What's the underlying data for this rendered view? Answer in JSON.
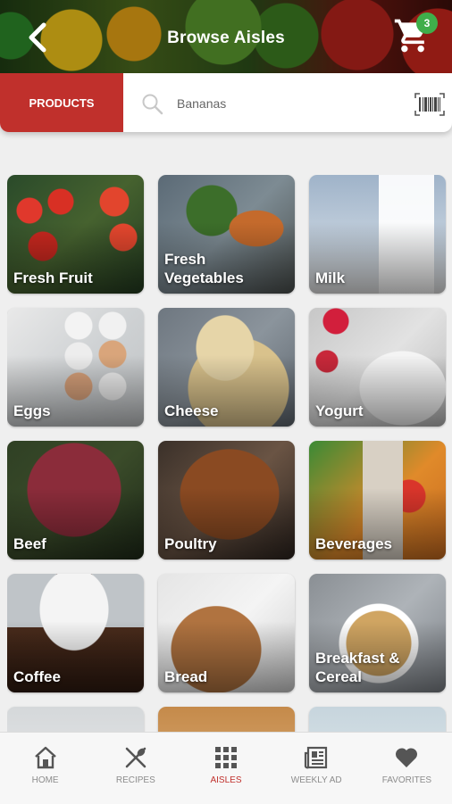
{
  "header": {
    "title": "Browse Aisles",
    "cart_count": "3"
  },
  "search": {
    "tab_label": "PRODUCTS",
    "value": "Bananas"
  },
  "aisles": [
    {
      "label": "Fresh Fruit"
    },
    {
      "label": "Fresh\nVegetables"
    },
    {
      "label": "Milk"
    },
    {
      "label": "Eggs"
    },
    {
      "label": "Cheese"
    },
    {
      "label": "Yogurt"
    },
    {
      "label": "Beef"
    },
    {
      "label": "Poultry"
    },
    {
      "label": "Beverages"
    },
    {
      "label": "Coffee"
    },
    {
      "label": "Bread"
    },
    {
      "label": "Breakfast &\nCereal"
    }
  ],
  "nav": {
    "home": "HOME",
    "recipes": "RECIPES",
    "aisles": "AISLES",
    "weekly_ad": "WEEKLY AD",
    "favorites": "FAVORITES"
  },
  "colors": {
    "accent": "#c0302c",
    "badge": "#3fae4a"
  }
}
